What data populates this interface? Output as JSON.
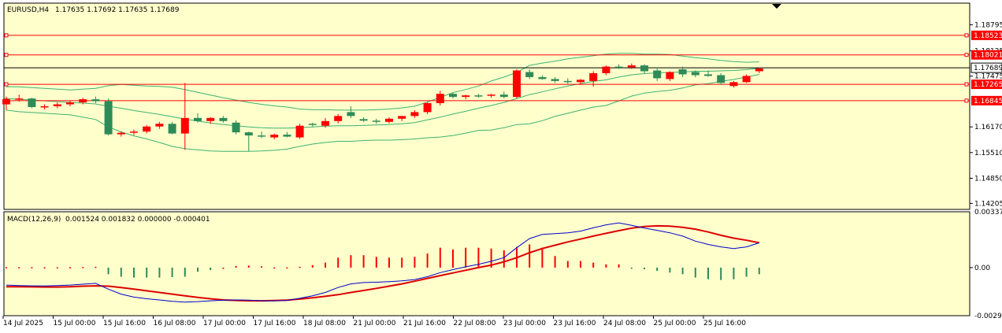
{
  "header": {
    "symbol": "EURUSD,H4",
    "ohlc": "1.17635 1.17692 1.17635 1.17689"
  },
  "colors": {
    "background": "#ffffcc",
    "bull": "#ff0000",
    "bear": "#2e8b57",
    "bollinger": "#3cb371",
    "hline": "#ff0000",
    "macd_line": "#0000cc",
    "signal_line": "#dd0000"
  },
  "chart_data": [
    {
      "type": "candlestick",
      "title": "EURUSD,H4",
      "ylim": [
        1.1405,
        1.1935
      ],
      "y_ticks": [
        "1.18795",
        "1.18125",
        "1.17475",
        "1.16170",
        "1.15510",
        "1.14850",
        "1.14205"
      ],
      "price_tags": {
        "current": "1.17689",
        "levels": [
          "1.18523",
          "1.18021",
          "1.17265",
          "1.16845"
        ]
      },
      "horizontal_levels": [
        1.18523,
        1.18021,
        1.17265,
        1.16845
      ],
      "current_price": 1.17689,
      "x_ticks": [
        "14 Jul 2025",
        "15 Jul 00:00",
        "15 Jul 16:00",
        "16 Jul 08:00",
        "17 Jul 00:00",
        "17 Jul 16:00",
        "18 Jul 08:00",
        "21 Jul 00:00",
        "21 Jul 16:00",
        "22 Jul 08:00",
        "23 Jul 00:00",
        "23 Jul 16:00",
        "24 Jul 08:00",
        "25 Jul 00:00",
        "25 Jul 16:00"
      ],
      "candles": [
        [
          1.1675,
          1.1695,
          1.166,
          1.1688
        ],
        [
          1.1688,
          1.17,
          1.1682,
          1.169
        ],
        [
          1.169,
          1.1692,
          1.1665,
          1.1668
        ],
        [
          1.1668,
          1.1675,
          1.1662,
          1.167
        ],
        [
          1.167,
          1.168,
          1.1665,
          1.1675
        ],
        [
          1.1675,
          1.1684,
          1.167,
          1.168
        ],
        [
          1.168,
          1.1692,
          1.1675,
          1.1688
        ],
        [
          1.1688,
          1.1695,
          1.1678,
          1.1683
        ],
        [
          1.1683,
          1.169,
          1.1595,
          1.1598
        ],
        [
          1.1598,
          1.1605,
          1.1592,
          1.1602
        ],
        [
          1.1602,
          1.161,
          1.1596,
          1.1605
        ],
        [
          1.1605,
          1.1622,
          1.16,
          1.1618
        ],
        [
          1.1618,
          1.163,
          1.1612,
          1.1625
        ],
        [
          1.1625,
          1.163,
          1.1598,
          1.16
        ],
        [
          1.16,
          1.173,
          1.1558,
          1.164
        ],
        [
          1.164,
          1.1652,
          1.1628,
          1.1632
        ],
        [
          1.1632,
          1.1642,
          1.1625,
          1.164
        ],
        [
          1.164,
          1.1645,
          1.1628,
          1.1632
        ],
        [
          1.1628,
          1.1634,
          1.1598,
          1.1603
        ],
        [
          1.1603,
          1.1605,
          1.1555,
          1.1595
        ],
        [
          1.1595,
          1.1605,
          1.1588,
          1.1592
        ],
        [
          1.159,
          1.16,
          1.1585,
          1.1597
        ],
        [
          1.1597,
          1.1604,
          1.159,
          1.1592
        ],
        [
          1.159,
          1.1625,
          1.1586,
          1.162
        ],
        [
          1.1625,
          1.1628,
          1.1618,
          1.1622
        ],
        [
          1.162,
          1.164,
          1.1615,
          1.1632
        ],
        [
          1.1632,
          1.165,
          1.1626,
          1.1645
        ],
        [
          1.1655,
          1.167,
          1.164,
          1.1645
        ],
        [
          1.1637,
          1.1642,
          1.163,
          1.1633
        ],
        [
          1.1633,
          1.1638,
          1.1625,
          1.163
        ],
        [
          1.163,
          1.1642,
          1.1626,
          1.1638
        ],
        [
          1.1638,
          1.1645,
          1.1632,
          1.1645
        ],
        [
          1.1645,
          1.166,
          1.164,
          1.1655
        ],
        [
          1.1655,
          1.168,
          1.165,
          1.1678
        ],
        [
          1.1678,
          1.171,
          1.1672,
          1.1702
        ],
        [
          1.1702,
          1.1705,
          1.169,
          1.1694
        ],
        [
          1.1694,
          1.17,
          1.1688,
          1.1698
        ],
        [
          1.1698,
          1.1702,
          1.1692,
          1.1697
        ],
        [
          1.1697,
          1.1702,
          1.1692,
          1.17
        ],
        [
          1.17,
          1.1708,
          1.169,
          1.1694
        ],
        [
          1.1694,
          1.1765,
          1.169,
          1.1762
        ],
        [
          1.1758,
          1.1765,
          1.174,
          1.1745
        ],
        [
          1.1745,
          1.175,
          1.1738,
          1.174
        ],
        [
          1.174,
          1.1745,
          1.173,
          1.1735
        ],
        [
          1.1735,
          1.1742,
          1.1728,
          1.1732
        ],
        [
          1.1732,
          1.174,
          1.1725,
          1.1738
        ],
        [
          1.1735,
          1.176,
          1.172,
          1.1755
        ],
        [
          1.1755,
          1.1775,
          1.175,
          1.1772
        ],
        [
          1.1772,
          1.1778,
          1.1766,
          1.177
        ],
        [
          1.177,
          1.178,
          1.1766,
          1.1775
        ],
        [
          1.1775,
          1.1778,
          1.1755,
          1.176
        ],
        [
          1.1762,
          1.177,
          1.1735,
          1.1742
        ],
        [
          1.174,
          1.176,
          1.1735,
          1.1758
        ],
        [
          1.1765,
          1.1772,
          1.1745,
          1.1752
        ],
        [
          1.1758,
          1.1762,
          1.1745,
          1.175
        ],
        [
          1.1752,
          1.1762,
          1.1746,
          1.1748
        ],
        [
          1.175,
          1.1755,
          1.1725,
          1.173
        ],
        [
          1.1722,
          1.1735,
          1.1718,
          1.1732
        ],
        [
          1.1732,
          1.1752,
          1.173,
          1.1748
        ],
        [
          1.176,
          1.1769,
          1.1755,
          1.1767
        ]
      ],
      "bollinger": {
        "upper": [
          1.172,
          1.172,
          1.1718,
          1.1716,
          1.1714,
          1.1712,
          1.1714,
          1.1716,
          1.1723,
          1.1726,
          1.1724,
          1.1722,
          1.1721,
          1.1719,
          1.1713,
          1.1706,
          1.1699,
          1.1692,
          1.1686,
          1.168,
          1.1675,
          1.1671,
          1.1668,
          1.1663,
          1.1661,
          1.1661,
          1.166,
          1.166,
          1.166,
          1.1661,
          1.1663,
          1.1666,
          1.167,
          1.1681,
          1.1693,
          1.1705,
          1.1713,
          1.1722,
          1.1735,
          1.1745,
          1.1757,
          1.1775,
          1.1781,
          1.1786,
          1.1792,
          1.1796,
          1.18,
          1.1804,
          1.1806,
          1.1806,
          1.1804,
          1.1804,
          1.1803,
          1.1799,
          1.1795,
          1.1792,
          1.1788,
          1.1785,
          1.1783,
          1.1784
        ],
        "middle": [
          1.169,
          1.1688,
          1.1686,
          1.1684,
          1.1682,
          1.168,
          1.1678,
          1.1676,
          1.167,
          1.1665,
          1.1659,
          1.1654,
          1.1649,
          1.1643,
          1.1637,
          1.1632,
          1.1627,
          1.1623,
          1.162,
          1.1617,
          1.1615,
          1.1614,
          1.1614,
          1.1615,
          1.1617,
          1.1619,
          1.162,
          1.162,
          1.1621,
          1.1622,
          1.1623,
          1.1625,
          1.1628,
          1.1635,
          1.1642,
          1.165,
          1.1657,
          1.1665,
          1.1672,
          1.168,
          1.169,
          1.17,
          1.1707,
          1.1715,
          1.1722,
          1.1728,
          1.1734,
          1.1738,
          1.1745,
          1.1751,
          1.1754,
          1.1756,
          1.1757,
          1.1758,
          1.176,
          1.176,
          1.1761,
          1.1762,
          1.1764,
          1.1768
        ],
        "lower": [
          1.166,
          1.1656,
          1.1654,
          1.1652,
          1.165,
          1.1648,
          1.1642,
          1.1636,
          1.1617,
          1.1604,
          1.1594,
          1.1586,
          1.1577,
          1.1567,
          1.1561,
          1.1558,
          1.1555,
          1.1554,
          1.1554,
          1.1554,
          1.1555,
          1.1557,
          1.156,
          1.1567,
          1.1573,
          1.1577,
          1.158,
          1.158,
          1.1582,
          1.1583,
          1.1583,
          1.1584,
          1.1586,
          1.1589,
          1.1591,
          1.1595,
          1.1601,
          1.1608,
          1.1609,
          1.1615,
          1.1623,
          1.1625,
          1.1633,
          1.1644,
          1.1652,
          1.166,
          1.1668,
          1.1672,
          1.1684,
          1.1696,
          1.1704,
          1.1708,
          1.1711,
          1.1717,
          1.1725,
          1.1728,
          1.1734,
          1.1739,
          1.1745,
          1.1752
        ]
      }
    },
    {
      "type": "macd",
      "title": "MACD(12,26,9)",
      "values_text": "0.001524 0.001832 0.000000 -0.000401",
      "ylim": [
        -0.0029,
        0.00337
      ],
      "y_ticks": [
        "0.003371",
        "0.00",
        "-0.0029"
      ],
      "histogram": [
        3e-05,
        3e-05,
        3e-05,
        2e-05,
        2e-05,
        3e-05,
        4e-05,
        5e-05,
        -0.0004,
        -0.00055,
        -0.0006,
        -0.0006,
        -0.0006,
        -0.00057,
        -0.00055,
        -0.00025,
        -0.00015,
        0.0,
        0.0001,
        0.00012,
        8e-05,
        2e-05,
        2e-05,
        5e-05,
        0.00015,
        0.0003,
        0.0006,
        0.00075,
        0.00075,
        0.00065,
        0.0006,
        0.0006,
        0.00065,
        0.00085,
        0.0012,
        0.0011,
        0.0012,
        0.0012,
        0.00115,
        0.00105,
        0.00125,
        0.0014,
        0.0012,
        0.0007,
        0.0004,
        0.0004,
        0.0003,
        0.0002,
        0.0002,
        -2e-05,
        -0.0001,
        -0.0002,
        -0.0003,
        -0.0004,
        -0.0006,
        -0.0007,
        -0.00075,
        -0.0007,
        -0.00055,
        -0.0004
      ],
      "macd": [
        -0.00105,
        -0.00108,
        -0.0011,
        -0.00111,
        -0.00108,
        -0.00105,
        -0.001,
        -0.00095,
        -0.0013,
        -0.0016,
        -0.00178,
        -0.00188,
        -0.00195,
        -0.00203,
        -0.00208,
        -0.00205,
        -0.002,
        -0.00196,
        -0.00195,
        -0.00196,
        -0.002,
        -0.002,
        -0.00198,
        -0.00185,
        -0.0017,
        -0.0015,
        -0.0012,
        -0.00098,
        -0.0009,
        -0.00088,
        -0.00085,
        -0.0008,
        -0.00072,
        -0.00055,
        -0.0003,
        -0.00012,
        5e-05,
        0.0002,
        0.00038,
        0.0006,
        0.0012,
        0.00175,
        0.002,
        0.00205,
        0.0021,
        0.0022,
        0.0024,
        0.00258,
        0.0027,
        0.00255,
        0.00238,
        0.00225,
        0.0021,
        0.0019,
        0.0016,
        0.0014,
        0.00125,
        0.00115,
        0.00125,
        0.0015
      ],
      "signal": [
        -0.00115,
        -0.00115,
        -0.00116,
        -0.00117,
        -0.00117,
        -0.00115,
        -0.00112,
        -0.0011,
        -0.00112,
        -0.0012,
        -0.0013,
        -0.0014,
        -0.0015,
        -0.0016,
        -0.0017,
        -0.0018,
        -0.00188,
        -0.00195,
        -0.00198,
        -0.002,
        -0.002,
        -0.00199,
        -0.00196,
        -0.0019,
        -0.00182,
        -0.00173,
        -0.00163,
        -0.0015,
        -0.00138,
        -0.00125,
        -0.00112,
        -0.00098,
        -0.00082,
        -0.00065,
        -0.00048,
        -0.00032,
        -0.00016,
        0.0,
        0.00015,
        0.00035,
        0.0006,
        0.0009,
        0.00115,
        0.00135,
        0.00155,
        0.00172,
        0.0019,
        0.00207,
        0.00223,
        0.00238,
        0.00248,
        0.00252,
        0.0025,
        0.00243,
        0.00232,
        0.00215,
        0.00195,
        0.00178,
        0.00165,
        0.0015
      ]
    }
  ]
}
